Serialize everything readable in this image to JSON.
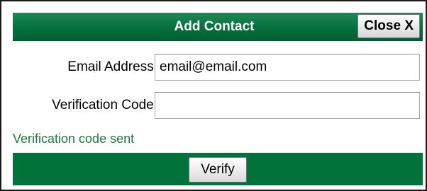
{
  "dialog": {
    "title": "Add Contact",
    "close_label": "Close X"
  },
  "form": {
    "email": {
      "label": "Email Address:",
      "value": "email@email.com"
    },
    "verification_code": {
      "label": "Verification Code:",
      "value": ""
    }
  },
  "status": {
    "message": "Verification code sent",
    "color": "#1d7a3a"
  },
  "footer": {
    "verify_label": "Verify"
  },
  "colors": {
    "header_green": "#08733f",
    "footer_green": "#00723a"
  }
}
